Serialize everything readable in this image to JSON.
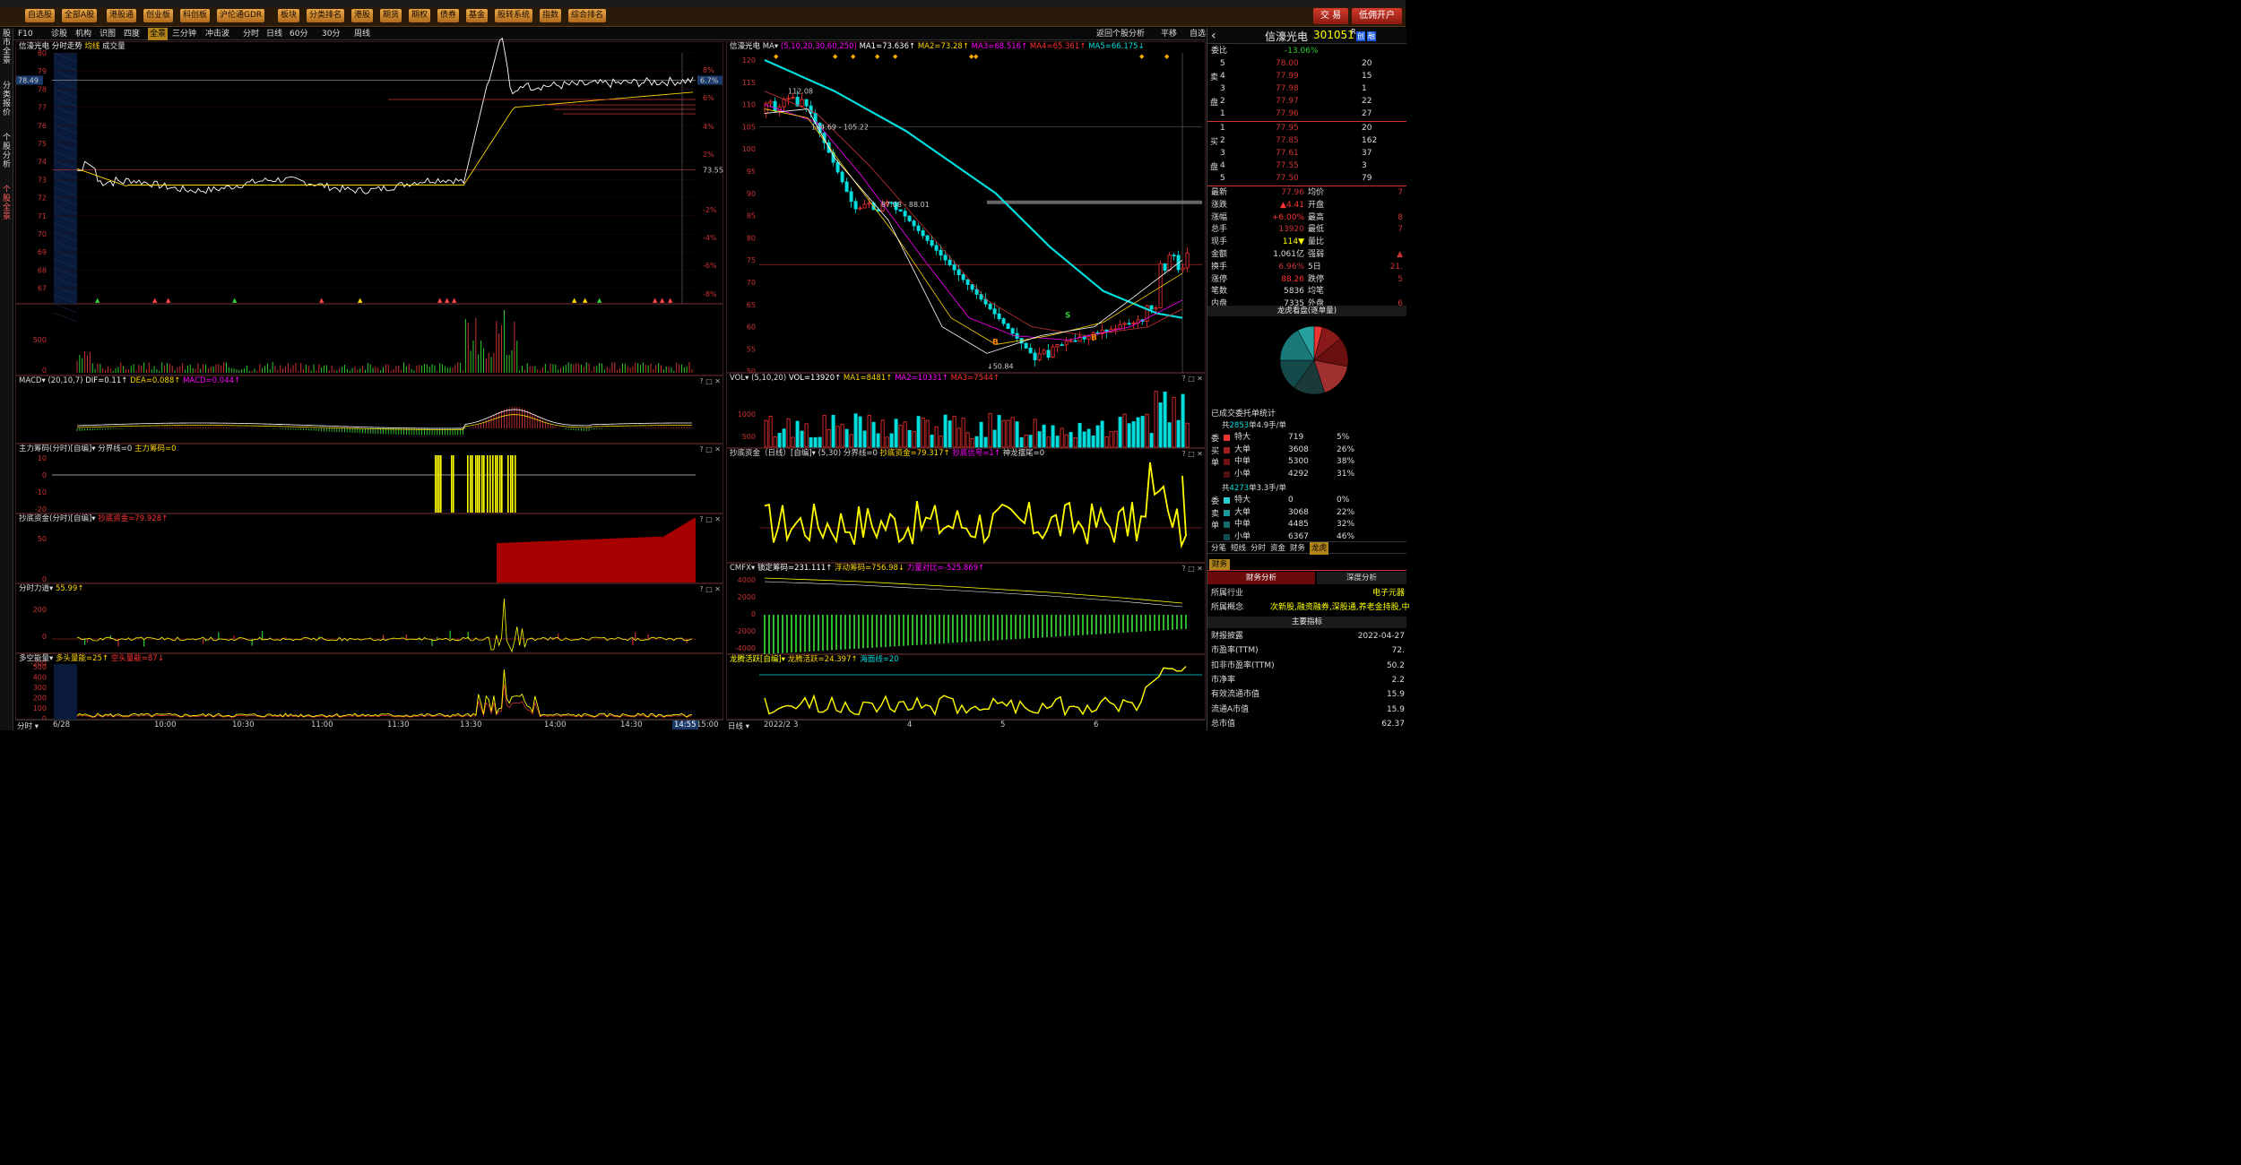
{
  "menubar": {
    "buttons": [
      "自选股",
      "全部A股",
      "港股通",
      "创业板",
      "科创板",
      "沪伦通GDR",
      "板块",
      "分类排名",
      "港股",
      "期货",
      "期权",
      "债券",
      "基金",
      "股转系统",
      "指数",
      "综合排名"
    ],
    "trade": "交 易",
    "open_account": "低佣开户"
  },
  "sidebar": {
    "items": [
      "股市全景",
      "分类报价",
      "个股分析",
      "个股全景"
    ]
  },
  "toolbar": {
    "items": [
      "F10",
      "诊股",
      "机构",
      "识图",
      "四度",
      "全景",
      "三分钟",
      "冲击波"
    ],
    "periods": [
      "分时",
      "日线",
      "60分",
      "30分",
      "周线"
    ],
    "right": [
      "返回个股分析",
      "平移",
      "自选"
    ]
  },
  "left_chart": {
    "title": "信濠光电",
    "sub": "分时走势",
    "avg_label": "均线",
    "vol_label": "成交量",
    "price_ticks": [
      "80",
      "79",
      "78",
      "77",
      "76",
      "75",
      "74",
      "73",
      "72",
      "71",
      "70",
      "69",
      "68",
      "67"
    ],
    "pct_ticks": [
      "8%",
      "6%",
      "4%",
      "2%",
      "-2%",
      "-4%",
      "-6%",
      "-8%"
    ],
    "cur_price": "78.49",
    "cur_pct": "6.7%",
    "ref": "73.55",
    "vol_tick": "500",
    "vol_zero": "0",
    "macd": {
      "name": "MACD",
      "params": "(20,10,7)",
      "dif": "DIF=0.11↑",
      "dea": "DEA=0.088↑",
      "macd": "MACD=0.044↑"
    },
    "zlcm": {
      "name": "主力筹码(分时)[自编]",
      "a": "分界线=0",
      "b": "主力筹码=0",
      "ticks": [
        "10",
        "0",
        "-10",
        "-20"
      ]
    },
    "cdzj": {
      "name": "抄底资金(分时)[自编]",
      "a": "抄底资金=79.928↑",
      "ticks": [
        "50",
        "0"
      ]
    },
    "fsld": {
      "name": "分时力道",
      "a": "55.99↑",
      "ticks": [
        "200",
        "0",
        "-200"
      ]
    },
    "dkn": {
      "name": "多空能量",
      "a": "多头量能=25↑",
      "b": "空头量能=87↓",
      "ticks": [
        "500",
        "400",
        "300",
        "200",
        "100",
        "0"
      ]
    },
    "time_axis": {
      "label": "分时",
      "ticks": [
        "6/28",
        "10:00",
        "10:30",
        "11:00",
        "11:30",
        "13:30",
        "14:00",
        "14:30",
        "15:00"
      ],
      "cursor": "14:55"
    }
  },
  "mid_chart": {
    "title": "信濠光电",
    "ma": "MA",
    "params": "(5,10,20,30,60,250)",
    "ma_values": [
      "MA1=73.636↑",
      "MA2=73.28↑",
      "MA3=68.516↑",
      "MA4=65.361↑",
      "MA5=66.175↓"
    ],
    "price_ticks": [
      "120",
      "115",
      "110",
      "105",
      "100",
      "95",
      "90",
      "85",
      "80",
      "75",
      "70",
      "65",
      "60",
      "55",
      "50"
    ],
    "annot": {
      "hi": "112.08",
      "r1": "104.69 - 105.22",
      "r2": "87.08 - 88.01",
      "lo": "50.84"
    },
    "vol": {
      "name": "VOL",
      "params": "(5,10,20)",
      "v": "VOL=13920↑",
      "ma1": "MA1=8481↑",
      "ma2": "MA2=10331↑",
      "ma3": "MA3=7544↑",
      "ticks": [
        "1000",
        "500"
      ]
    },
    "cdzj": {
      "name": "抄底资金（日线）[自编]",
      "params": "(5,30)",
      "a": "分界线=0",
      "b": "抄底资金=79.317↑",
      "c": "抄底信号=1↑",
      "d": "神龙摆尾=0"
    },
    "cmfx": {
      "name": "CMFX",
      "a": "锁定筹码=231.111↑",
      "b": "浮动筹码=756.98↓",
      "c": "力量对比=-525.869↑",
      "ticks": [
        "4000",
        "2000",
        "0",
        "-2000",
        "-4000"
      ]
    },
    "lths": {
      "name": "龙腾活跃[自编]",
      "a": "龙腾活跃=24.397↑",
      "b": "海面线=20"
    },
    "time_axis": {
      "label": "日线",
      "ticks": [
        "2022/2",
        "3",
        "4",
        "5",
        "6"
      ]
    }
  },
  "right_panel": {
    "name": "信濠光电",
    "code": "301051",
    "r_badge": "R",
    "x_badge": "创",
    "mode": "融",
    "weibi_label": "委比",
    "weibi": "-13.06%",
    "sell_label": "卖",
    "buy_label": "买",
    "pan_label": "盘",
    "sell": [
      [
        "5",
        "78.00",
        "20"
      ],
      [
        "4",
        "77.99",
        "15"
      ],
      [
        "3",
        "77.98",
        "1"
      ],
      [
        "2",
        "77.97",
        "22"
      ],
      [
        "1",
        "77.96",
        "27"
      ]
    ],
    "buy": [
      [
        "1",
        "77.95",
        "20"
      ],
      [
        "2",
        "77.85",
        "162"
      ],
      [
        "3",
        "77.61",
        "37"
      ],
      [
        "4",
        "77.55",
        "3"
      ],
      [
        "5",
        "77.50",
        "79"
      ]
    ],
    "stats": [
      [
        "最新",
        "77.96",
        "均价",
        "7"
      ],
      [
        "涨跌",
        "▲4.41",
        "开盘",
        ""
      ],
      [
        "涨幅",
        "+6.00%",
        "最高",
        "8"
      ],
      [
        "总手",
        "13920",
        "最低",
        "7"
      ],
      [
        "现手",
        "114▼",
        "量比",
        ""
      ],
      [
        "金额",
        "1.061亿",
        "强弱",
        "▲"
      ],
      [
        "换手",
        "6.96%",
        "5日",
        "21."
      ],
      [
        "涨停",
        "88.26",
        "跌停",
        "5"
      ],
      [
        "笔数",
        "5836",
        "均笔",
        ""
      ],
      [
        "内盘",
        "7335",
        "外盘",
        "6"
      ]
    ],
    "dragon_title": "龙虎看盘(逐单量)",
    "deal_title": "已成交委托单统计",
    "deal_sum1_pre": "共",
    "deal_sum1_n": "2853",
    "deal_sum1_post": "单4.9手/单",
    "deal_rows": [
      [
        "特大",
        "719",
        "5%"
      ],
      [
        "大单",
        "3608",
        "26%"
      ],
      [
        "中单",
        "5300",
        "38%"
      ],
      [
        "小单",
        "4292",
        "31%"
      ]
    ],
    "deal_sum2_pre": "共",
    "deal_sum2_n": "4273",
    "deal_sum2_post": "单3.3手/单",
    "deal_rows2": [
      [
        "特大",
        "0",
        "0%"
      ],
      [
        "大单",
        "3068",
        "22%"
      ],
      [
        "中单",
        "4485",
        "32%"
      ],
      [
        "小单",
        "6367",
        "46%"
      ]
    ],
    "side_labels": [
      "委",
      "买",
      "单"
    ],
    "side_labels2": [
      "委",
      "卖",
      "单"
    ],
    "tabs": [
      "分笔",
      "短线",
      "分时",
      "资金",
      "财务",
      "龙虎"
    ],
    "fin_tab": "财务",
    "fin_sub": [
      "财务分析",
      "深度分析"
    ],
    "industry_label": "所属行业",
    "industry": "电子元器",
    "concept_label": "所属概念",
    "concept": "次新股,融资融券,深股通,养老金持股,中",
    "main_idx": "主要指标",
    "fin_rows": [
      [
        "财报披露",
        "2022-04-27"
      ],
      [
        "市盈率(TTM)",
        "72."
      ],
      [
        "扣非市盈率(TTM)",
        "50.2"
      ],
      [
        "市净率",
        "2.2"
      ],
      [
        "有效流通市值",
        "15.9"
      ],
      [
        "流通A市值",
        "15.9"
      ],
      [
        "总市值",
        "62.37"
      ]
    ]
  }
}
